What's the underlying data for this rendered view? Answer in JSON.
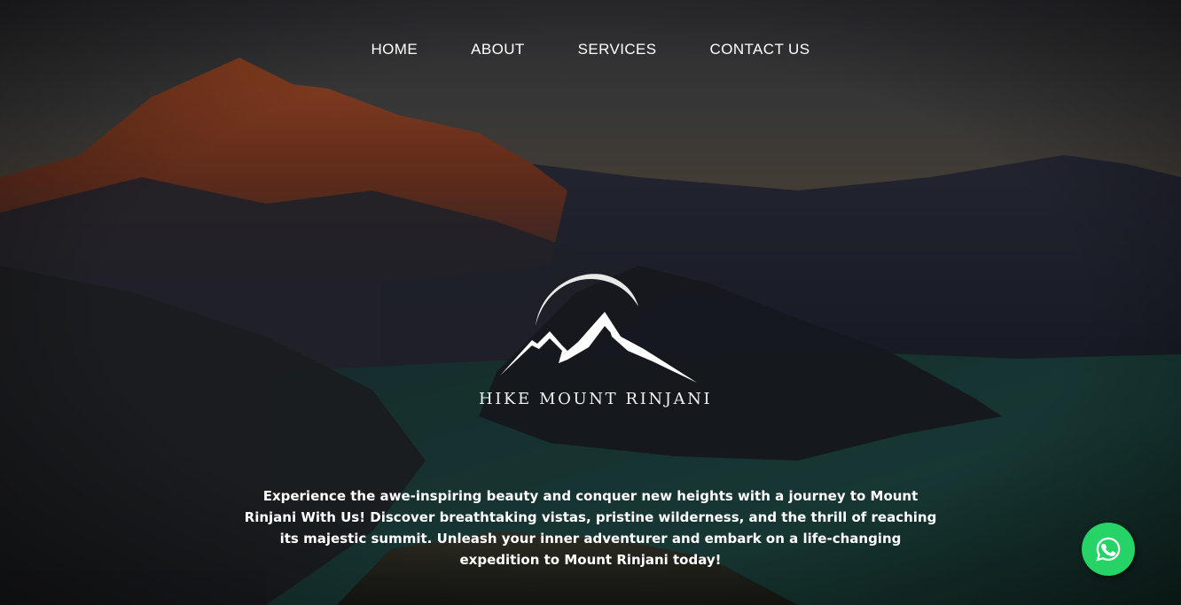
{
  "nav": {
    "items": [
      {
        "label": "HOME"
      },
      {
        "label": "ABOUT"
      },
      {
        "label": "SERVICES"
      },
      {
        "label": "CONTACT US"
      }
    ]
  },
  "hero": {
    "brand": "HIKE MOUNT RINJANI",
    "tagline": "Experience the awe-inspiring beauty and conquer new heights with a journey to Mount Rinjani With Us! Discover breathtaking vistas, pristine wilderness, and the thrill of reaching its majestic summit. Unleash your inner adventurer and embark on a life-changing expedition to Mount Rinjani today!"
  },
  "whatsapp": {
    "icon": "whatsapp-icon",
    "color": "#25d366"
  }
}
